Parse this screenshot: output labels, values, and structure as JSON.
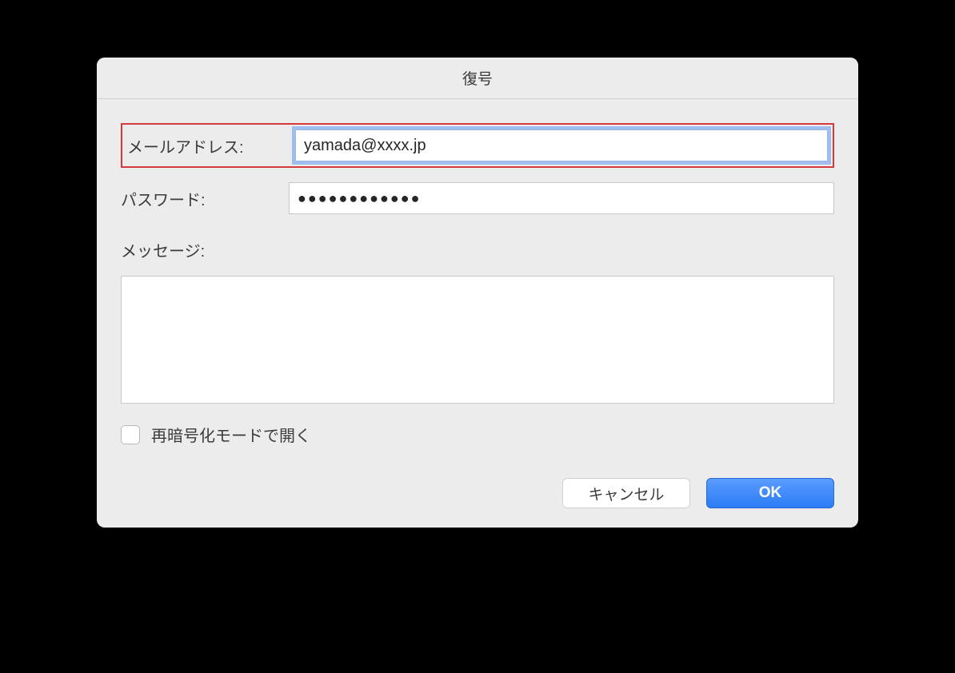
{
  "dialog": {
    "title": "復号",
    "email": {
      "label": "メールアドレス:",
      "value": "yamada@xxxx.jp"
    },
    "password": {
      "label": "パスワード:",
      "value": "●●●●●●●●●●●●"
    },
    "message": {
      "label": "メッセージ:",
      "value": ""
    },
    "checkbox": {
      "label": "再暗号化モードで開く",
      "checked": false
    },
    "buttons": {
      "cancel": "キャンセル",
      "ok": "OK"
    }
  }
}
